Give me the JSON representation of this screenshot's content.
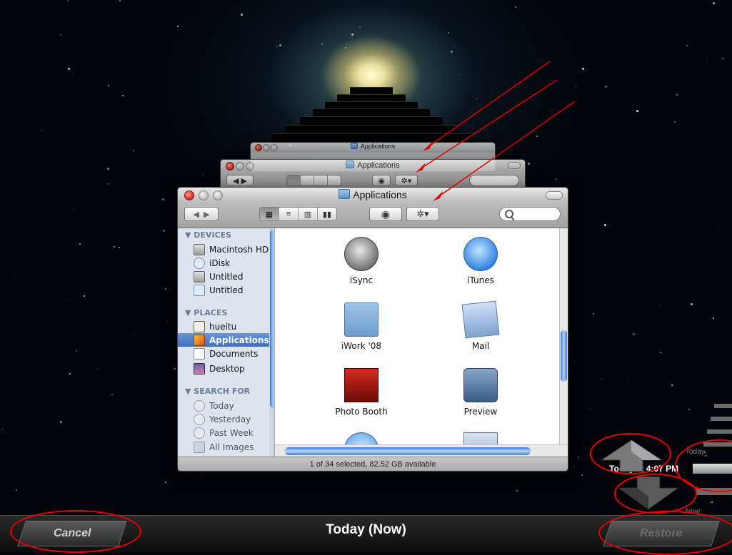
{
  "finder": {
    "title": "Applications",
    "view_buttons": [
      "icon-view",
      "list-view",
      "column-view",
      "coverflow-view"
    ],
    "sidebar": {
      "devices_header": "▼ DEVICES",
      "devices": [
        "Macintosh HD",
        "iDisk",
        "Untitled",
        "Untitled"
      ],
      "places_header": "▼ PLACES",
      "places": [
        "hueitu",
        "Applications",
        "Documents",
        "Desktop"
      ],
      "search_header": "▼ SEARCH FOR",
      "searches": [
        "Today",
        "Yesterday",
        "Past Week",
        "All Images"
      ],
      "selected": "Applications"
    },
    "apps": [
      {
        "name": "iSync",
        "icon": "isync-icon"
      },
      {
        "name": "iTunes",
        "icon": "itunes-icon"
      },
      {
        "name": "iWork '08",
        "icon": "folder-icon"
      },
      {
        "name": "Mail",
        "icon": "mail-icon"
      },
      {
        "name": "Photo Booth",
        "icon": "photo-booth-icon"
      },
      {
        "name": "Preview",
        "icon": "preview-icon"
      }
    ],
    "status": "1 of 34 selected, 82.52 GB available"
  },
  "background_windows": [
    {
      "title": "Applications"
    },
    {
      "title": "Applications"
    }
  ],
  "time_machine": {
    "cancel_label": "Cancel",
    "center_label": "Today (Now)",
    "restore_label": "Restore",
    "timeline_today_label": "Today",
    "timeline_now_label": "Now",
    "snapshot_label": "Today at 4:07 PM"
  },
  "annotation_color": "#e00000"
}
